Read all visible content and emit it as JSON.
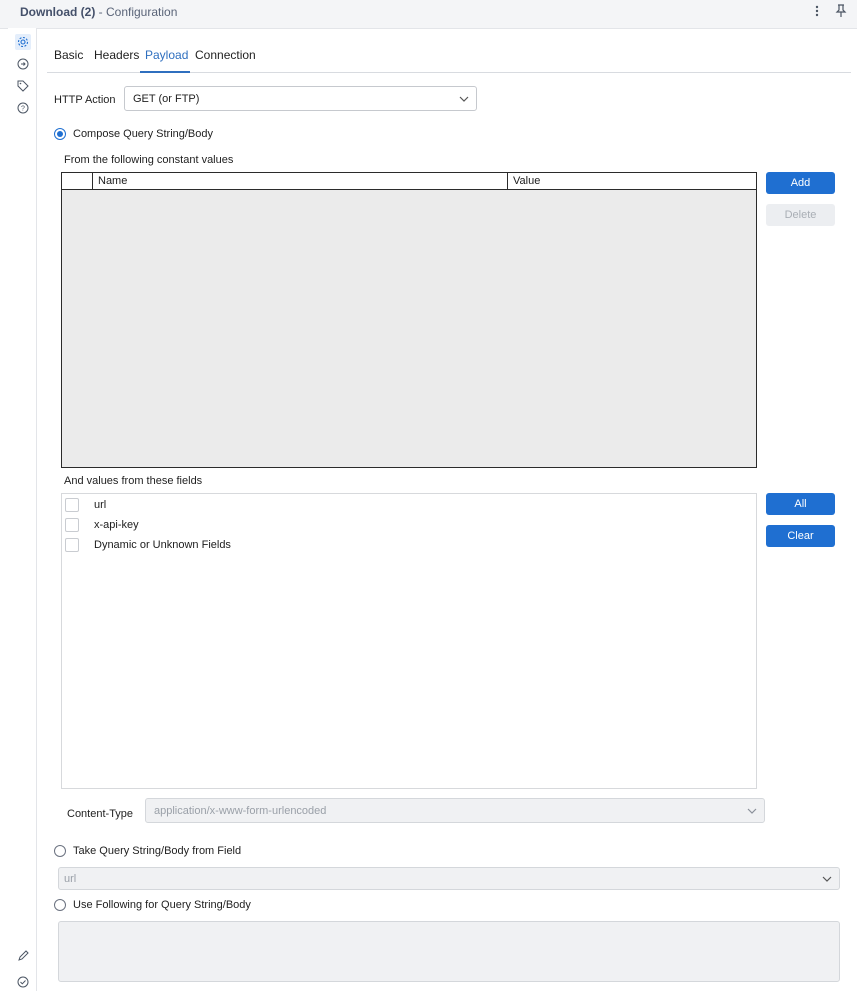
{
  "window": {
    "title": "Download (2)",
    "subtitle": " - Configuration"
  },
  "tabs": [
    {
      "label": "Basic"
    },
    {
      "label": "Headers"
    },
    {
      "label": "Payload"
    },
    {
      "label": "Connection"
    }
  ],
  "active_tab": "Payload",
  "http_action": {
    "label": "HTTP Action",
    "value": "GET (or FTP)"
  },
  "compose": {
    "label": "Compose Query String/Body",
    "selected": true,
    "constants_label": "From the following constant values",
    "columns": [
      "Name",
      "Value"
    ],
    "rows": [],
    "add_label": "Add",
    "delete_label": "Delete"
  },
  "fields": {
    "label": "And values from these fields",
    "items": [
      {
        "label": "url",
        "checked": false
      },
      {
        "label": "x-api-key",
        "checked": false
      },
      {
        "label": "Dynamic or Unknown Fields",
        "checked": false
      }
    ],
    "all_label": "All",
    "clear_label": "Clear"
  },
  "content_type": {
    "label": "Content-Type",
    "value": "application/x-www-form-urlencoded"
  },
  "take_from_field": {
    "label": "Take Query String/Body from Field",
    "selected": false,
    "value": "url"
  },
  "use_following": {
    "label": "Use Following for Query String/Body",
    "selected": false,
    "value": ""
  },
  "colors": {
    "accent": "#1f6fd1",
    "tab_active": "#2f6fbf"
  },
  "icons": {
    "left_rail": [
      "gear-icon",
      "connection-icon",
      "tag-icon",
      "help-icon",
      "pencil-icon",
      "check-circle-icon"
    ],
    "title_bar": [
      "more-vertical-icon",
      "pin-icon"
    ]
  }
}
